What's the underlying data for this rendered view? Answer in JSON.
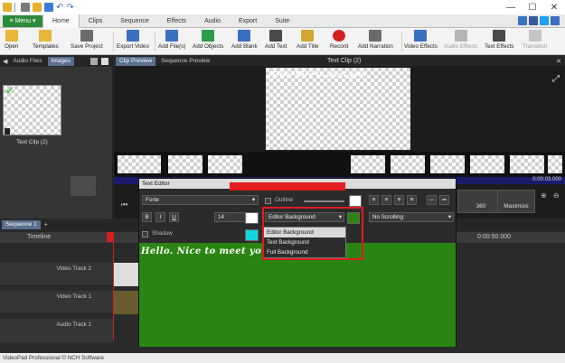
{
  "colors": {
    "menu_green": "#2e8b3a",
    "accent_blue": "#5a6f8f",
    "highlight_red": "#e21b1b",
    "editor_green": "#2a8512",
    "cyan_swatch": "#11d6e0"
  },
  "window": {
    "minimize": "—",
    "maximize": "☐",
    "close": "✕"
  },
  "menu": {
    "menu_button": "≡ Menu ▾",
    "tabs": [
      "Home",
      "Clips",
      "Sequence",
      "Effects",
      "Audio",
      "Export",
      "Suite"
    ]
  },
  "toolbar": {
    "items": [
      "Open",
      "Templates",
      "Save Project",
      "Export Video",
      "Add File(s)",
      "Add Objects",
      "Add Blank",
      "Add Text",
      "Add Title",
      "Record",
      "Add Narration",
      "Video Effects",
      "Audio Effects",
      "Text Effects",
      "Transition"
    ]
  },
  "left_panel": {
    "tabs": [
      "Audio Files",
      "Images"
    ],
    "clip_label": "Text Clip (2)"
  },
  "preview": {
    "tabs": [
      "Clip Preview",
      "Sequence Preview"
    ],
    "title": "Text Clip (2)",
    "preview_text": "Hello. Nice to meet you!",
    "speed_label": "360",
    "maximize_label": "Maximize",
    "time": "0:00:03.000"
  },
  "timeline": {
    "tab": "Sequence 1",
    "add_tab": "+",
    "ruler_label": "Timeline",
    "ruler_time": "0:00:50.000",
    "tracks": [
      "Video Track 2",
      "Video Track 1",
      "Audio Track 1"
    ]
  },
  "status": {
    "text": "VideoPad Professional © NCH Software"
  },
  "text_editor": {
    "title": "Text Editor",
    "font": "Forte",
    "bold": "B",
    "italic": "I",
    "underline": "U",
    "size": "14",
    "outline_label": "Outline",
    "shadow_label": "Shadow",
    "background_select": "Editor Background",
    "scroll_select": "No Scrolling",
    "dropdown_options": [
      "Editor Background",
      "Text Background",
      "Full Background"
    ],
    "selected_option_index": 0,
    "sample_text": "Hello. Nice to meet you!"
  }
}
